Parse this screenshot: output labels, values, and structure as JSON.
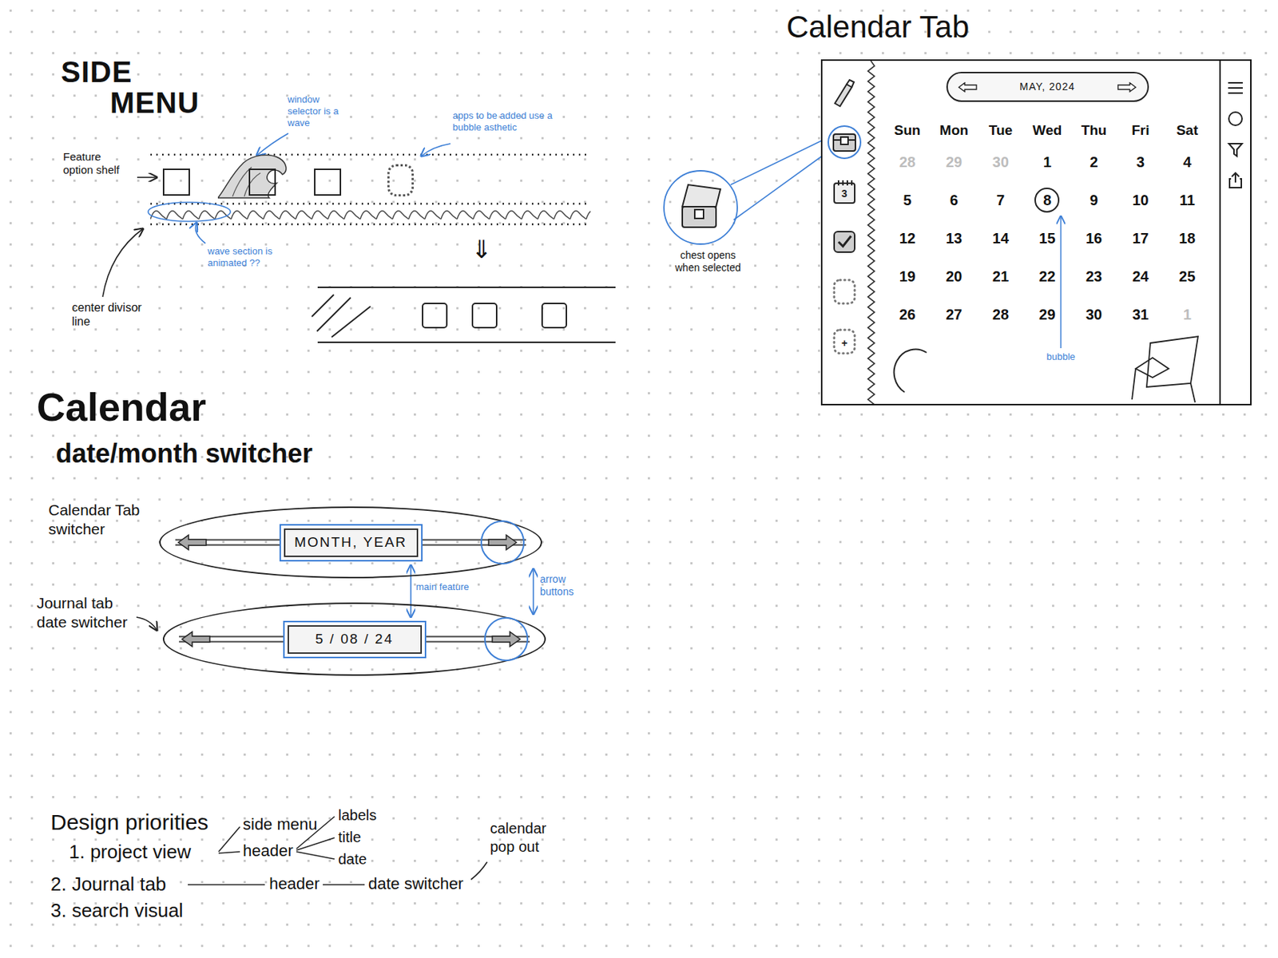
{
  "side_menu": {
    "title": [
      "SIDE",
      "MENU"
    ],
    "notes": [
      {
        "text": "window selector is a wave",
        "color": "#3d7fd6"
      },
      {
        "text": "apps to be added use a bubble asthetic",
        "color": "#3d7fd6"
      },
      {
        "text": "Feature option shelf",
        "color": "#111111"
      },
      {
        "text": "wave section is animated ??",
        "color": "#3d7fd6"
      },
      {
        "text": "center divisor line",
        "color": "#111111"
      }
    ],
    "slots": [
      {
        "kind": "box",
        "selected": false
      },
      {
        "kind": "box",
        "selected": true
      },
      {
        "kind": "box",
        "selected": false
      },
      {
        "kind": "bubble",
        "selected": false
      }
    ],
    "collapse_arrow": "⇓"
  },
  "calendar_tab": {
    "title": "Calendar Tab",
    "month": "MAY, 2024",
    "weekdays": [
      "Sun",
      "Mon",
      "Tue",
      "Wed",
      "Thu",
      "Fri",
      "Sat"
    ],
    "days": [
      {
        "text": "28",
        "muted": true,
        "selected": false
      },
      {
        "text": "29",
        "muted": true,
        "selected": false
      },
      {
        "text": "30",
        "muted": true,
        "selected": false
      },
      {
        "text": "1",
        "muted": false,
        "selected": false
      },
      {
        "text": "2",
        "muted": false,
        "selected": false
      },
      {
        "text": "3",
        "muted": false,
        "selected": false
      },
      {
        "text": "4",
        "muted": false,
        "selected": false
      },
      {
        "text": "5",
        "muted": false,
        "selected": false
      },
      {
        "text": "6",
        "muted": false,
        "selected": false
      },
      {
        "text": "7",
        "muted": false,
        "selected": false
      },
      {
        "text": "8",
        "muted": false,
        "selected": true
      },
      {
        "text": "9",
        "muted": false,
        "selected": false
      },
      {
        "text": "10",
        "muted": false,
        "selected": false
      },
      {
        "text": "11",
        "muted": false,
        "selected": false
      },
      {
        "text": "12",
        "muted": false,
        "selected": false
      },
      {
        "text": "13",
        "muted": false,
        "selected": false
      },
      {
        "text": "14",
        "muted": false,
        "selected": false
      },
      {
        "text": "15",
        "muted": false,
        "selected": false
      },
      {
        "text": "16",
        "muted": false,
        "selected": false
      },
      {
        "text": "17",
        "muted": false,
        "selected": false
      },
      {
        "text": "18",
        "muted": false,
        "selected": false
      },
      {
        "text": "19",
        "muted": false,
        "selected": false
      },
      {
        "text": "20",
        "muted": false,
        "selected": false
      },
      {
        "text": "21",
        "muted": false,
        "selected": false
      },
      {
        "text": "22",
        "muted": false,
        "selected": false
      },
      {
        "text": "23",
        "muted": false,
        "selected": false
      },
      {
        "text": "24",
        "muted": false,
        "selected": false
      },
      {
        "text": "25",
        "muted": false,
        "selected": false
      },
      {
        "text": "26",
        "muted": false,
        "selected": false
      },
      {
        "text": "27",
        "muted": false,
        "selected": false
      },
      {
        "text": "28",
        "muted": false,
        "selected": false
      },
      {
        "text": "29",
        "muted": false,
        "selected": false
      },
      {
        "text": "30",
        "muted": false,
        "selected": false
      },
      {
        "text": "31",
        "muted": false,
        "selected": false
      },
      {
        "text": "1",
        "muted": true,
        "selected": false
      }
    ],
    "sidebar": [
      {
        "kind": "bottle",
        "selected": false
      },
      {
        "kind": "chest",
        "selected": true
      },
      {
        "kind": "calendar",
        "selected": false,
        "text": "3"
      },
      {
        "kind": "checklist",
        "selected": false
      },
      {
        "kind": "bubble",
        "selected": false
      },
      {
        "kind": "add",
        "selected": false,
        "text": "+"
      }
    ],
    "notes": [
      {
        "text": "chest opens when selected",
        "color": "#111111"
      },
      {
        "text": "bubble",
        "color": "#3d7fd6"
      }
    ]
  },
  "switcher": {
    "title": "Calendar",
    "subtitle": "date/month switcher",
    "rows": [
      {
        "label": "Calendar Tab switcher",
        "value": "MONTH, YEAR"
      },
      {
        "label": "Journal tab date switcher",
        "value": "5 / 08 / 24"
      }
    ],
    "notes": [
      {
        "text": "main feature",
        "color": "#3d7fd6"
      },
      {
        "text": "arrow buttons",
        "color": "#3d7fd6"
      }
    ]
  },
  "priorities": {
    "title": "Design priorities",
    "items": [
      "1. project view",
      "2. Journal tab",
      "3. search visual"
    ],
    "branches": [
      "side menu",
      "header",
      "labels",
      "title",
      "date",
      "header",
      "date switcher",
      "calendar pop out"
    ]
  }
}
